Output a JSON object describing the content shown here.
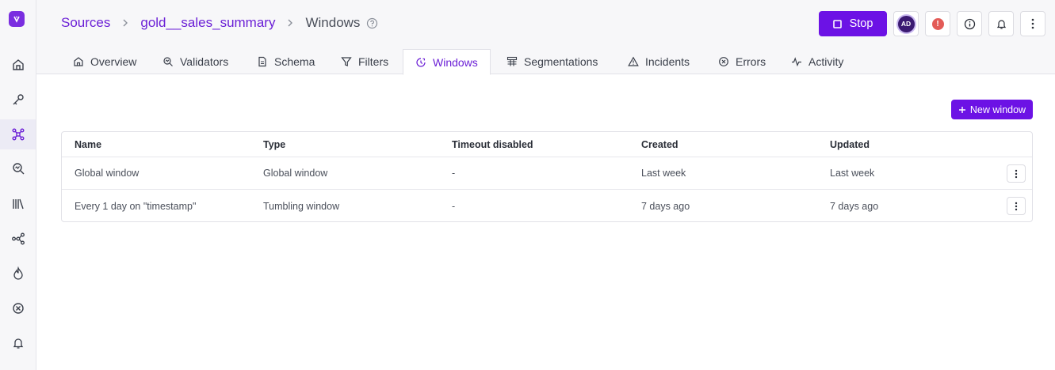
{
  "breadcrumb": {
    "sources": "Sources",
    "source_name": "gold__sales_summary",
    "current": "Windows"
  },
  "header": {
    "stop_label": "Stop",
    "avatar_initials": "AD",
    "alert_symbol": "!"
  },
  "tabs": [
    {
      "label": "Overview",
      "icon": "home-icon"
    },
    {
      "label": "Validators",
      "icon": "validator-icon"
    },
    {
      "label": "Schema",
      "icon": "document-icon"
    },
    {
      "label": "Filters",
      "icon": "filter-icon"
    },
    {
      "label": "Windows",
      "icon": "window-clock-icon",
      "active": true
    },
    {
      "label": "Segmentations",
      "icon": "segmentation-icon"
    },
    {
      "label": "Incidents",
      "icon": "warning-icon"
    },
    {
      "label": "Errors",
      "icon": "error-circle-icon"
    },
    {
      "label": "Activity",
      "icon": "activity-icon"
    }
  ],
  "sidebar": {
    "items": [
      "home-icon",
      "key-icon",
      "sources-icon",
      "validators-icon",
      "library-icon",
      "lineage-icon",
      "fire-icon",
      "errors-icon",
      "bell-icon"
    ]
  },
  "main": {
    "new_window_label": "New window",
    "table": {
      "columns": [
        "Name",
        "Type",
        "Timeout disabled",
        "Created",
        "Updated"
      ],
      "rows": [
        {
          "name": "Global window",
          "type": "Global window",
          "timeout": "-",
          "created": "Last week",
          "updated": "Last week"
        },
        {
          "name": "Every 1 day on \"timestamp\"",
          "type": "Tumbling window",
          "timeout": "-",
          "created": "7 days ago",
          "updated": "7 days ago"
        }
      ]
    }
  },
  "colors": {
    "accent": "#6c12e5",
    "link": "#6b1fd6"
  }
}
